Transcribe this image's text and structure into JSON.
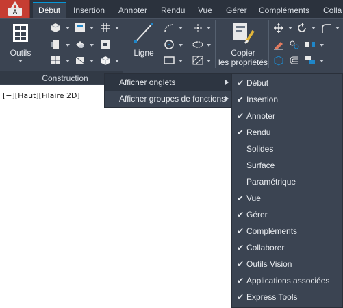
{
  "app_button": {
    "label": "A"
  },
  "tabs": [
    {
      "label": "Début",
      "active": true
    },
    {
      "label": "Insertion",
      "active": false
    },
    {
      "label": "Annoter",
      "active": false
    },
    {
      "label": "Rendu",
      "active": false
    },
    {
      "label": "Vue",
      "active": false
    },
    {
      "label": "Gérer",
      "active": false
    },
    {
      "label": "Compléments",
      "active": false
    },
    {
      "label": "Colla",
      "active": false
    }
  ],
  "ribbon": {
    "outils_label": "Outils",
    "construction_panel_title": "Construction",
    "ligne_label": "Ligne",
    "copier_label_line1": "Copier",
    "copier_label_line2": "les propriétés"
  },
  "viewport": {
    "label": "[−][Haut][Filaire 2D]"
  },
  "context_menu": {
    "items": [
      {
        "label": "Afficher onglets",
        "has_submenu": true,
        "highlighted": true
      },
      {
        "label": "Afficher groupes de fonctions",
        "has_submenu": true,
        "highlighted": false
      }
    ]
  },
  "submenu": {
    "items": [
      {
        "label": "Début",
        "checked": true
      },
      {
        "label": "Insertion",
        "checked": true
      },
      {
        "label": "Annoter",
        "checked": true
      },
      {
        "label": "Rendu",
        "checked": true
      },
      {
        "label": "Solides",
        "checked": false
      },
      {
        "label": "Surface",
        "checked": false
      },
      {
        "label": "Paramétrique",
        "checked": false
      },
      {
        "label": "Vue",
        "checked": true
      },
      {
        "label": "Gérer",
        "checked": true
      },
      {
        "label": "Compléments",
        "checked": true
      },
      {
        "label": "Collaborer",
        "checked": true
      },
      {
        "label": "Outils Vision",
        "checked": true
      },
      {
        "label": "Applications associées",
        "checked": true
      },
      {
        "label": "Express Tools",
        "checked": true
      }
    ],
    "check_glyph": "✔"
  },
  "colors": {
    "ribbon_bg": "#3b4452",
    "tabbar_bg": "#2b323d",
    "app_button": "#c63d32",
    "accent": "#0696d7"
  }
}
